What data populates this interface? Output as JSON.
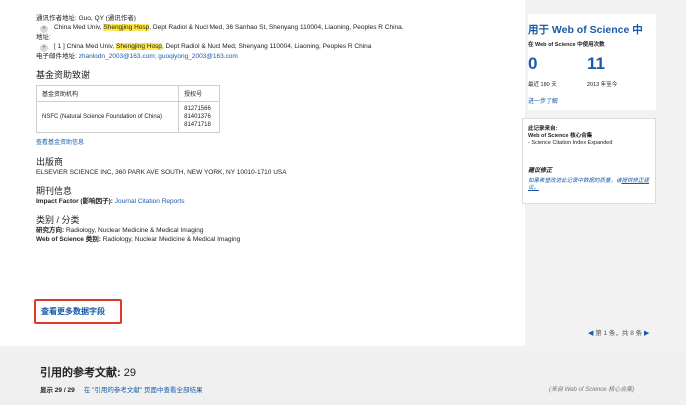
{
  "record": {
    "corr_author_label": "通讯作者地址:",
    "corr_author_value": "Guo, QY (通讯作者)",
    "corr_addr_pre": "China Med Univ, ",
    "corr_addr_hl": "Shengjing Hosp",
    "corr_addr_post": ", Dept Radiol & Nucl Med, 36 Sanhao St, Shenyang 110004, Liaoning, Peoples R China.",
    "address_label": "地址:",
    "addr_pre": "[ 1 ] China Med Univ, ",
    "addr_hl": "Shengjing Hosp",
    "addr_post": ", Dept Radiol & Nucl Med, Shenyang 110004, Liaoning, Peoples R China",
    "email_label": "电子邮件地址:",
    "email_value": "zhanlodn_2003@163.com; guoqiyong_2003@163.com"
  },
  "funding": {
    "title": "基金资助致谢",
    "col_agency": "基金资助机构",
    "col_grant": "授权号",
    "agency": "NSFC (Natural Science Foundation of China)",
    "grants": [
      "81271566",
      "81401376",
      "81471718"
    ],
    "link": "查看基金资助信息"
  },
  "publisher": {
    "title": "出版商",
    "value": "ELSEVIER SCIENCE INC, 360 PARK AVE SOUTH, NEW YORK, NY 10010-1710 USA"
  },
  "journal": {
    "title": "期刊信息",
    "if_label": "Impact Factor (影响因子):",
    "if_link": "Journal Citation Reports"
  },
  "category": {
    "title": "类别 / 分类",
    "area_label": "研究方向:",
    "area_value": "Radiology, Nuclear Medicine & Medical Imaging",
    "wos_label": "Web of Science 类别:",
    "wos_value": "Radiology, Nuclear Medicine & Medical Imaging"
  },
  "more_fields": "查看更多数据字段",
  "pager": {
    "prev": "◀",
    "text": "第 1 条，共 8 条",
    "next": "▶"
  },
  "usage": {
    "title": "用于 Web of Science 中",
    "subtitle": "在 Web of Science 中使用次数",
    "count_180": "0",
    "count_2013": "11",
    "caption_180": "最近 180 天",
    "caption_2013": "2013 年至今",
    "learn_more": "进一步了解"
  },
  "source": {
    "label": "此记录来自:",
    "collection": "Web of Science 核心合集",
    "index": "- Science Citation Index Expanded"
  },
  "suggest": {
    "title": "建议修正",
    "body": "如果希望改进此记录中数据的质量，请",
    "link": "提供修正建议。"
  },
  "references": {
    "title": "引用的参考文献:",
    "count": "29",
    "show": "显示 29 / 29",
    "view_all": "在 \"引用的参考文献\" 页面中查看全部结果",
    "note": "(来自 Web of Science 核心合集)"
  },
  "colors": {
    "link": "#1a5aa8",
    "highlight": "#ffe94d",
    "annotation": "#e0392b"
  }
}
